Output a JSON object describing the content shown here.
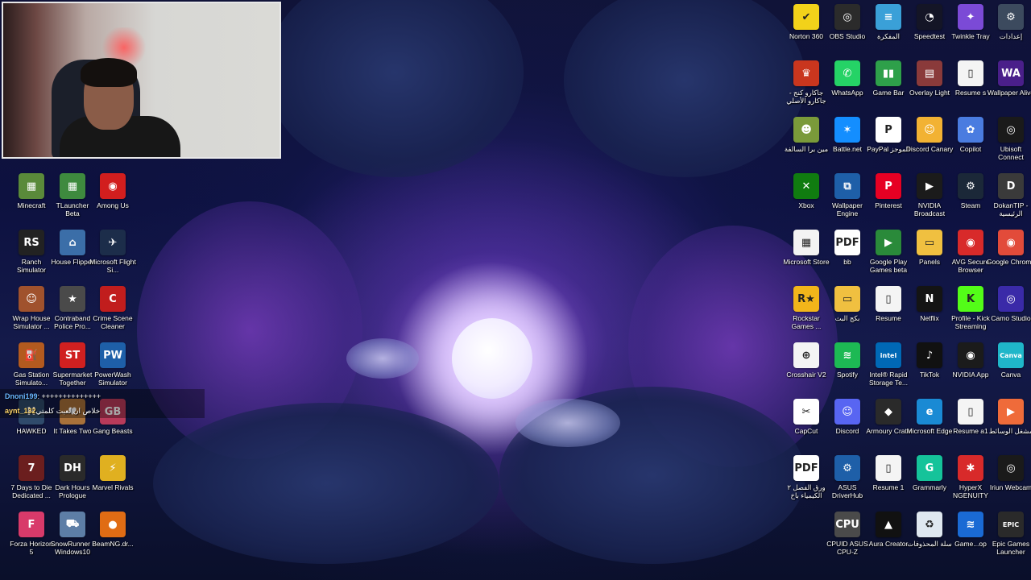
{
  "chat": {
    "user1": "Dnoni199",
    "msg1": ": ++++++++++++++",
    "user2": "aynt_132",
    "msg2": "خلاص ان لعبت كلمتي"
  },
  "desktop_left": [
    {
      "label": "Minecraft",
      "icon": "minecraft-icon",
      "color": "#5a8a3a",
      "sym": "▦"
    },
    {
      "label": "TLauncher Beta",
      "icon": "tlauncher-icon",
      "color": "#3e8a3e",
      "sym": "▦"
    },
    {
      "label": "Among Us",
      "icon": "among-us-icon",
      "color": "#d21e1e",
      "sym": "◉"
    },
    {
      "label": "Ranch Simulator",
      "icon": "ranch-simulator-icon",
      "color": "#222222",
      "sym": "RS"
    },
    {
      "label": "House Flipper",
      "icon": "house-flipper-icon",
      "color": "#3b6ea8",
      "sym": "⌂"
    },
    {
      "label": "Microsoft Flight Si...",
      "icon": "flight-simulator-icon",
      "color": "#1c2d4a",
      "sym": "✈"
    },
    {
      "label": "Wrap House Simulator ...",
      "icon": "wrap-house-icon",
      "color": "#a0522d",
      "sym": "☺"
    },
    {
      "label": "Contraband Police Pro...",
      "icon": "contraband-police-icon",
      "color": "#4a4a4a",
      "sym": "★"
    },
    {
      "label": "Crime Scene Cleaner",
      "icon": "crime-scene-icon",
      "color": "#c11d1d",
      "sym": "C"
    },
    {
      "label": "Gas Station Simulato...",
      "icon": "gas-station-icon",
      "color": "#b35a1f",
      "sym": "⛽"
    },
    {
      "label": "Supermarket Together",
      "icon": "supermarket-icon",
      "color": "#d02020",
      "sym": "ST"
    },
    {
      "label": "PowerWash Simulator",
      "icon": "powerwash-icon",
      "color": "#1e5fa8",
      "sym": "PW"
    },
    {
      "label": "HAWKED",
      "icon": "hawked-icon",
      "color": "#2f4a6b",
      "sym": "H"
    },
    {
      "label": "It Takes Two",
      "icon": "it-takes-two-icon",
      "color": "#a8713a",
      "sym": "♥"
    },
    {
      "label": "Gang Beasts",
      "icon": "gang-beasts-icon",
      "color": "#b83a5a",
      "sym": "GB"
    },
    {
      "label": "7 Days to Die Dedicated ...",
      "icon": "7-days-to-die-icon",
      "color": "#6b1e1e",
      "sym": "7"
    },
    {
      "label": "Dark Hours Prologue",
      "icon": "dark-hours-icon",
      "color": "#2a2a2a",
      "sym": "DH"
    },
    {
      "label": "Marvel Rivals",
      "icon": "marvel-rivals-icon",
      "color": "#e0b020",
      "sym": "⚡"
    },
    {
      "label": "Forza Horizon 5",
      "icon": "forza-horizon-icon",
      "color": "#d83a6a",
      "sym": "F"
    },
    {
      "label": "SnowRunner - Windows10",
      "icon": "snowrunner-icon",
      "color": "#5d7ea6",
      "sym": "⛟"
    },
    {
      "label": "BeamNG.dr...",
      "icon": "beamng-icon",
      "color": "#e06c14",
      "sym": "●"
    }
  ],
  "desktop_right": [
    {
      "label": "Norton 360",
      "icon": "norton-icon",
      "color": "#f2d21a",
      "sym": "✔"
    },
    {
      "label": "OBS Studio",
      "icon": "obs-icon",
      "color": "#2b2b2b",
      "sym": "◎"
    },
    {
      "label": "المفكرة",
      "icon": "notepad-icon",
      "color": "#3aa0d8",
      "sym": "≡"
    },
    {
      "label": "Speedtest",
      "icon": "speedtest-icon",
      "color": "#141526",
      "sym": "◔"
    },
    {
      "label": "Twinkle Tray",
      "icon": "twinkle-tray-icon",
      "color": "#7b4ad6",
      "sym": "✦"
    },
    {
      "label": "إعدادات",
      "icon": "settings-icon",
      "color": "#3c4a5e",
      "sym": "⚙"
    },
    {
      "label": "جاكارو كنج - جاكارو الأصلي",
      "icon": "jackaroo-icon",
      "color": "#c9361e",
      "sym": "♛"
    },
    {
      "label": "WhatsApp",
      "icon": "whatsapp-icon",
      "color": "#25d366",
      "sym": "✆"
    },
    {
      "label": "Game Bar",
      "icon": "game-bar-icon",
      "color": "#2ea04a",
      "sym": "▮▮"
    },
    {
      "label": "Overlay Light",
      "icon": "overlay-light-icon",
      "color": "#8a3a3a",
      "sym": "▤"
    },
    {
      "label": "Resume s",
      "icon": "resume-file-icon",
      "color": "#f4f4f4",
      "sym": "▯"
    },
    {
      "label": "Wallpaper Alive",
      "icon": "wallpaper-alive-icon",
      "color": "#4a1f8a",
      "sym": "WA"
    },
    {
      "label": "مين برا السالفة",
      "icon": "game-icon",
      "color": "#7a9a3a",
      "sym": "☻"
    },
    {
      "label": "Battle.net",
      "icon": "battlenet-icon",
      "color": "#148eff",
      "sym": "✶"
    },
    {
      "label": "PayPal الموجز",
      "icon": "paypal-icon",
      "color": "#ffffff",
      "sym": "P"
    },
    {
      "label": "Discord Canary",
      "icon": "discord-canary-icon",
      "color": "#f2b233",
      "sym": "☺"
    },
    {
      "label": "Copilot",
      "icon": "copilot-icon",
      "color": "#4a7ce0",
      "sym": "✿"
    },
    {
      "label": "Ubisoft Connect",
      "icon": "ubisoft-icon",
      "color": "#1a1a1a",
      "sym": "◎"
    },
    {
      "label": "Xbox",
      "icon": "xbox-icon",
      "color": "#107c10",
      "sym": "✕"
    },
    {
      "label": "Wallpaper Engine",
      "icon": "wallpaper-engine-icon",
      "color": "#1e5fa8",
      "sym": "⧉"
    },
    {
      "label": "Pinterest",
      "icon": "pinterest-icon",
      "color": "#e60023",
      "sym": "P"
    },
    {
      "label": "NVIDIA Broadcast",
      "icon": "nvidia-broadcast-icon",
      "color": "#1b1b1b",
      "sym": "▶"
    },
    {
      "label": "Steam",
      "icon": "steam-icon",
      "color": "#1b2838",
      "sym": "⚙"
    },
    {
      "label": "DokanTIP - الرئيسية",
      "icon": "dokantip-icon",
      "color": "#3a3a3a",
      "sym": "D"
    },
    {
      "label": "Microsoft Store",
      "icon": "microsoft-store-icon",
      "color": "#f3f3f3",
      "sym": "▦"
    },
    {
      "label": "bb",
      "icon": "pdf-icon",
      "color": "#ffffff",
      "sym": "PDF"
    },
    {
      "label": "Google Play Games beta",
      "icon": "google-play-games-icon",
      "color": "#2a8a3a",
      "sym": "▶"
    },
    {
      "label": "Panels",
      "icon": "folder-icon",
      "color": "#f0c040",
      "sym": "▭"
    },
    {
      "label": "AVG Secure Browser",
      "icon": "avg-browser-icon",
      "color": "#d82a2a",
      "sym": "◉"
    },
    {
      "label": "Google Chrome",
      "icon": "chrome-icon",
      "color": "#e24b3a",
      "sym": "◉"
    },
    {
      "label": "Rockstar Games ...",
      "icon": "rockstar-icon",
      "color": "#f2b51a",
      "sym": "R★"
    },
    {
      "label": "بكج البث",
      "icon": "folder-icon",
      "color": "#f0c040",
      "sym": "▭"
    },
    {
      "label": "Resume",
      "icon": "resume-file-icon",
      "color": "#f4f4f4",
      "sym": "▯"
    },
    {
      "label": "Netflix",
      "icon": "netflix-icon",
      "color": "#141414",
      "sym": "N"
    },
    {
      "label": "Profile - Kick Streaming",
      "icon": "kick-icon",
      "color": "#53fc18",
      "sym": "K"
    },
    {
      "label": "Camo Studio",
      "icon": "camo-studio-icon",
      "color": "#3a2aa8",
      "sym": "◎"
    },
    {
      "label": "Crosshair V2",
      "icon": "crosshair-icon",
      "color": "#f4f4f4",
      "sym": "⊕"
    },
    {
      "label": "Spotify",
      "icon": "spotify-icon",
      "color": "#1db954",
      "sym": "≋"
    },
    {
      "label": "Intel® Rapid Storage Te...",
      "icon": "intel-icon",
      "color": "#0068b5",
      "sym": "intel"
    },
    {
      "label": "TikTok",
      "icon": "tiktok-icon",
      "color": "#111111",
      "sym": "♪"
    },
    {
      "label": "NVIDIA App",
      "icon": "nvidia-app-icon",
      "color": "#1b1b1b",
      "sym": "◉"
    },
    {
      "label": "Canva",
      "icon": "canva-icon",
      "color": "#1fb6c9",
      "sym": "Canva"
    },
    {
      "label": "CapCut",
      "icon": "capcut-icon",
      "color": "#ffffff",
      "sym": "✂"
    },
    {
      "label": "Discord",
      "icon": "discord-icon",
      "color": "#5865f2",
      "sym": "☺"
    },
    {
      "label": "Armoury Crate",
      "icon": "armoury-crate-icon",
      "color": "#2a2a2a",
      "sym": "◆"
    },
    {
      "label": "Microsoft Edge",
      "icon": "edge-icon",
      "color": "#1a8ad4",
      "sym": "e"
    },
    {
      "label": "Resume a1",
      "icon": "resume-file-icon",
      "color": "#f4f4f4",
      "sym": "▯"
    },
    {
      "label": "مشغل الوسائط",
      "icon": "media-player-icon",
      "color": "#ef6b3a",
      "sym": "▶"
    },
    {
      "label": "ورق الفصل ٢ الكيمياء باخ",
      "icon": "pdf-icon",
      "color": "#ffffff",
      "sym": "PDF"
    },
    {
      "label": "ASUS DriverHub",
      "icon": "asus-driverhub-icon",
      "color": "#1e5fa8",
      "sym": "⚙"
    },
    {
      "label": "Resume 1",
      "icon": "resume-file-icon",
      "color": "#f4f4f4",
      "sym": "▯"
    },
    {
      "label": "Grammarly",
      "icon": "grammarly-icon",
      "color": "#15c39a",
      "sym": "G"
    },
    {
      "label": "HyperX NGENUITY",
      "icon": "hyperx-icon",
      "color": "#d82a2a",
      "sym": "✱"
    },
    {
      "label": "Iriun Webcam",
      "icon": "iriun-webcam-icon",
      "color": "#1a1a1a",
      "sym": "◎"
    },
    {
      "label": "CPUID ASUS CPU-Z",
      "icon": "cpuz-icon",
      "color": "#4a4a4a",
      "sym": "CPU"
    },
    {
      "label": "Aura Creator",
      "icon": "aura-creator-icon",
      "color": "#111111",
      "sym": "▲"
    },
    {
      "label": "سلة المحذوفات",
      "icon": "recycle-bin-icon",
      "color": "#dfe8f0",
      "sym": "♻"
    },
    {
      "label": "Game...op",
      "icon": "game-launcher-icon",
      "color": "#1a6ad4",
      "sym": "≋"
    },
    {
      "label": "Epic Games Launcher",
      "icon": "epic-games-icon",
      "color": "#2a2a2a",
      "sym": "EPIC"
    }
  ]
}
